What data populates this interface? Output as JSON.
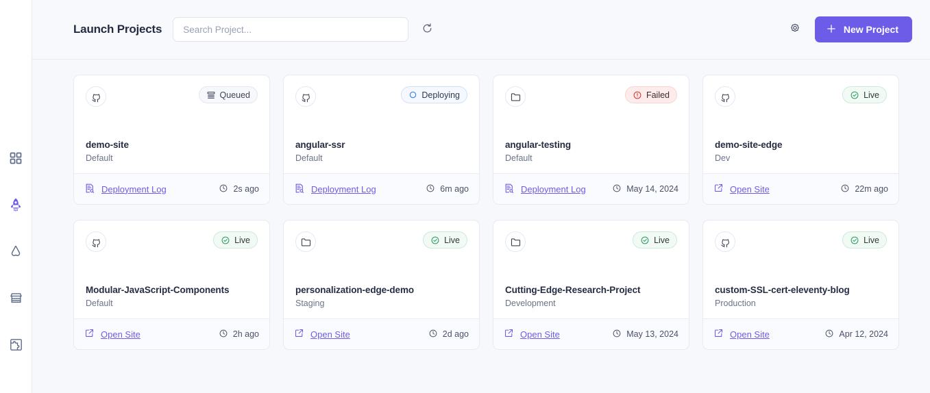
{
  "sidebar": {
    "items": [
      {
        "icon": "grid-dashboard-icon",
        "name": "sidebar-item-dashboard",
        "active": false
      },
      {
        "icon": "rocket-icon",
        "name": "sidebar-item-launch",
        "active": true
      },
      {
        "icon": "brand-logo-icon",
        "name": "sidebar-item-brand",
        "active": false
      },
      {
        "icon": "store-icon",
        "name": "sidebar-item-marketplace",
        "active": false
      },
      {
        "icon": "puzzle-icon",
        "name": "sidebar-item-integrations",
        "active": false
      }
    ]
  },
  "header": {
    "title": "Launch Projects",
    "search_placeholder": "Search Project...",
    "search_value": "",
    "refresh_icon": "refresh-icon",
    "settings_icon": "gear-icon",
    "new_project_label": "New Project",
    "new_project_icon": "plus-icon",
    "accent_color": "#6c5ce7"
  },
  "projects": [
    {
      "name": "demo-site",
      "environment": "Default",
      "source_icon": "github-icon",
      "status": {
        "label": "Queued",
        "type": "queued",
        "icon": "queue-list-icon",
        "color": "#3f4558"
      },
      "action": {
        "label": "Deployment Log",
        "icon": "deployment-log-icon"
      },
      "time": "2s ago",
      "time_icon": "clock-icon"
    },
    {
      "name": "angular-ssr",
      "environment": "Default",
      "source_icon": "github-icon",
      "status": {
        "label": "Deploying",
        "type": "deploying",
        "icon": "circle-icon",
        "color": "#3b82f6"
      },
      "action": {
        "label": "Deployment Log",
        "icon": "deployment-log-icon"
      },
      "time": "6m ago",
      "time_icon": "clock-icon"
    },
    {
      "name": "angular-testing",
      "environment": "Default",
      "source_icon": "folder-icon",
      "status": {
        "label": "Failed",
        "type": "failed",
        "icon": "alert-circle-icon",
        "color": "#d9352c"
      },
      "action": {
        "label": "Deployment Log",
        "icon": "deployment-log-icon"
      },
      "time": "May 14, 2024",
      "time_icon": "clock-icon"
    },
    {
      "name": "demo-site-edge",
      "environment": "Dev",
      "source_icon": "github-icon",
      "status": {
        "label": "Live",
        "type": "live",
        "icon": "check-circle-icon",
        "color": "#2e9e63"
      },
      "action": {
        "label": "Open Site",
        "icon": "external-link-icon"
      },
      "time": "22m ago",
      "time_icon": "clock-icon"
    },
    {
      "name": "Modular-JavaScript-Components",
      "environment": "Default",
      "source_icon": "github-icon",
      "status": {
        "label": "Live",
        "type": "live",
        "icon": "check-circle-icon",
        "color": "#2e9e63"
      },
      "action": {
        "label": "Open Site",
        "icon": "external-link-icon"
      },
      "time": "2h ago",
      "time_icon": "clock-icon"
    },
    {
      "name": "personalization-edge-demo",
      "environment": "Staging",
      "source_icon": "folder-icon",
      "status": {
        "label": "Live",
        "type": "live",
        "icon": "check-circle-icon",
        "color": "#2e9e63"
      },
      "action": {
        "label": "Open Site",
        "icon": "external-link-icon"
      },
      "time": "2d ago",
      "time_icon": "clock-icon"
    },
    {
      "name": "Cutting-Edge-Research-Project",
      "environment": "Development",
      "source_icon": "folder-icon",
      "status": {
        "label": "Live",
        "type": "live",
        "icon": "check-circle-icon",
        "color": "#2e9e63"
      },
      "action": {
        "label": "Open Site",
        "icon": "external-link-icon"
      },
      "time": "May 13, 2024",
      "time_icon": "clock-icon"
    },
    {
      "name": "custom-SSL-cert-eleventy-blog",
      "environment": "Production",
      "source_icon": "github-icon",
      "status": {
        "label": "Live",
        "type": "live",
        "icon": "check-circle-icon",
        "color": "#2e9e63"
      },
      "action": {
        "label": "Open Site",
        "icon": "external-link-icon"
      },
      "time": "Apr 12, 2024",
      "time_icon": "clock-icon"
    }
  ]
}
